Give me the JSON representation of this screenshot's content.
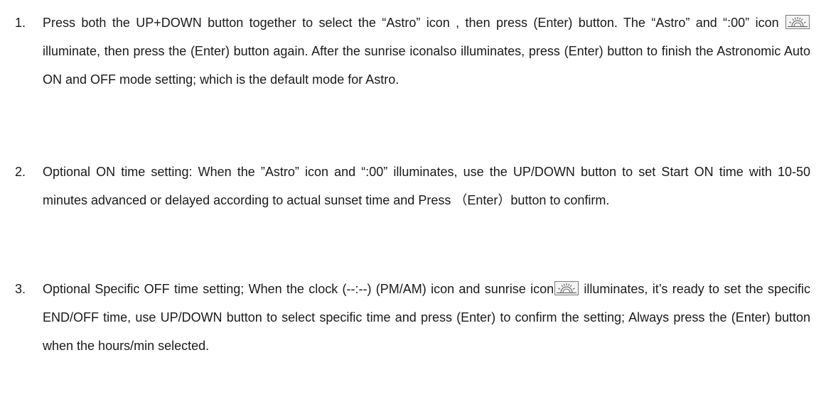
{
  "items": [
    {
      "number": "1.",
      "part1": "Press both the UP+DOWN button together to select the “Astro” icon , then press (Enter) button. The “Astro” and “:00” icon ",
      "icon1": "sunrise-icon",
      "part2": "illuminate, then press the (Enter) button again. After the sunrise iconalso illuminates, press (Enter) button to finish the Astronomic Auto ON and OFF mode setting; which is the default mode for Astro."
    },
    {
      "number": "2.",
      "text": "Optional ON time setting: When the ”Astro” icon and “:00” illuminates, use the UP/DOWN button to set Start ON time with 10-50 minutes advanced or delayed according to actual sunset time and Press （Enter）button to confirm."
    },
    {
      "number": "3.",
      "part1": "Optional Specific OFF time setting; When the clock (--:--) (PM/AM) icon and sunrise icon",
      "icon1": "sunrise-icon",
      "part2": " illuminates, it’s ready to set the specific END/OFF time, use UP/DOWN button to select specific time and press (Enter) to confirm the setting; Always press the (Enter) button when the hours/min selected."
    }
  ]
}
